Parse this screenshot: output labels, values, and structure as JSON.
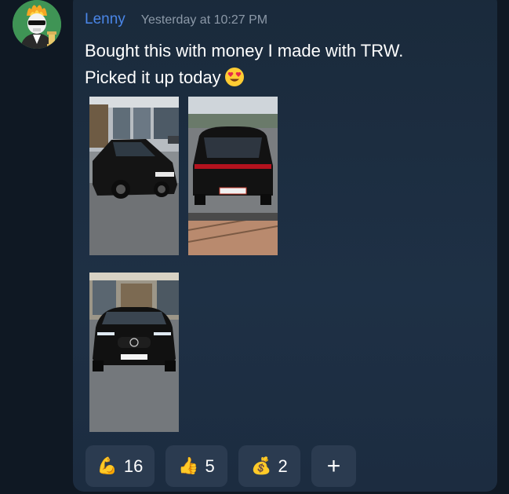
{
  "message": {
    "author": "Lenny",
    "timestamp": "Yesterday at 10:27 PM",
    "line1": "Bought this with money I made with TRW.",
    "line2": "Picked it up today",
    "emoji": "heart-eyes-emoji"
  },
  "attachments": [
    {
      "name": "photo-car-front-side"
    },
    {
      "name": "photo-car-rear"
    },
    {
      "name": "photo-car-front"
    }
  ],
  "reactions": [
    {
      "emoji": "💪",
      "icon": "flexed-biceps-icon",
      "count": "16"
    },
    {
      "emoji": "👍",
      "icon": "thumbs-up-icon",
      "count": "5"
    },
    {
      "emoji": "💰",
      "icon": "money-bag-icon",
      "count": "2"
    }
  ],
  "add_reaction": {
    "label": "+"
  },
  "colors": {
    "background": "#0f1823",
    "card": "#1e3045",
    "username": "#4a86e8",
    "timestamp": "#8c99a8",
    "reaction_bg": "#2b3b50"
  }
}
